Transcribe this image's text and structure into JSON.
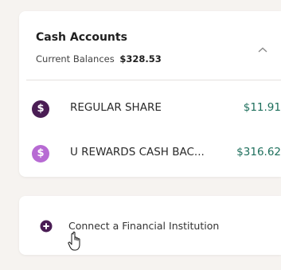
{
  "cash_accounts": {
    "title": "Cash Accounts",
    "subtitle_label": "Current Balances",
    "total": "$328.53",
    "collapse_icon": "chevron-up-icon",
    "accounts": [
      {
        "icon": "dollar-icon",
        "glyph": "$",
        "color": "#4a1d54",
        "name": "REGULAR SHARE",
        "balance": "$11.91"
      },
      {
        "icon": "dollar-icon",
        "glyph": "$",
        "color": "#b76ad3",
        "name": "U REWARDS CASH BAC...",
        "balance": "$316.62"
      }
    ]
  },
  "connect": {
    "label": "Connect a Financial Institution",
    "icon": "plus-circle-icon",
    "icon_color": "#4a1d54"
  },
  "colors": {
    "balance_green": "#1e6f5c",
    "brand_dark_purple": "#4a1d54",
    "brand_light_purple": "#b76ad3"
  }
}
